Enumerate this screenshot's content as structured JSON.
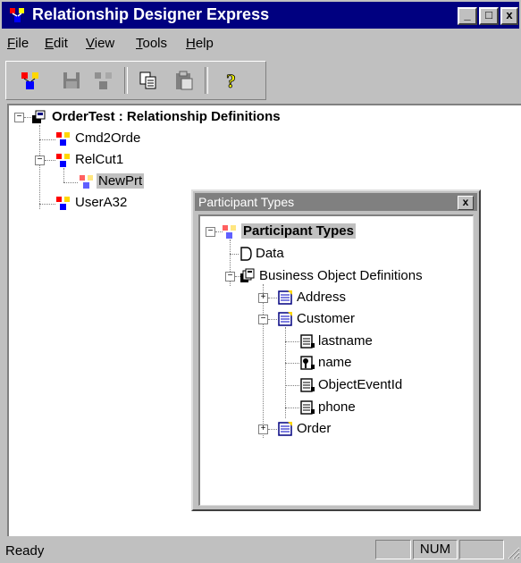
{
  "window": {
    "title": "Relationship Designer Express",
    "controls": {
      "minimize": "_",
      "maximize": "□",
      "close": "x"
    }
  },
  "menu": [
    {
      "label": "File",
      "mnemonic": "F",
      "rest": "ile"
    },
    {
      "label": "Edit",
      "mnemonic": "E",
      "rest": "dit"
    },
    {
      "label": "View",
      "mnemonic": "V",
      "rest": "iew"
    },
    {
      "label": "Tools",
      "mnemonic": "T",
      "rest": "ools"
    },
    {
      "label": "Help",
      "mnemonic": "H",
      "rest": "elp"
    }
  ],
  "toolbar": {
    "icons": [
      "relationship-new-icon",
      "save-icon",
      "relationship-disabled-icon",
      "copy-icon",
      "paste-icon",
      "help-icon"
    ]
  },
  "tree": {
    "root": "OrderTest : Relationship Definitions",
    "items": [
      "Cmd2Orde",
      "RelCut1",
      "NewPrt",
      "UserA32"
    ]
  },
  "participant_window": {
    "title": "Participant Types",
    "close": "x",
    "root": "Participant Types",
    "data": "Data",
    "bod": "Business Object Definitions",
    "address": "Address",
    "customer": "Customer",
    "attributes": [
      "lastname",
      "name",
      "ObjectEventId",
      "phone"
    ],
    "order": "Order"
  },
  "status": {
    "text": "Ready",
    "num": "NUM"
  },
  "colors": {
    "title_active": "#000080",
    "title_inactive": "#808080",
    "face": "#c0c0c0"
  }
}
